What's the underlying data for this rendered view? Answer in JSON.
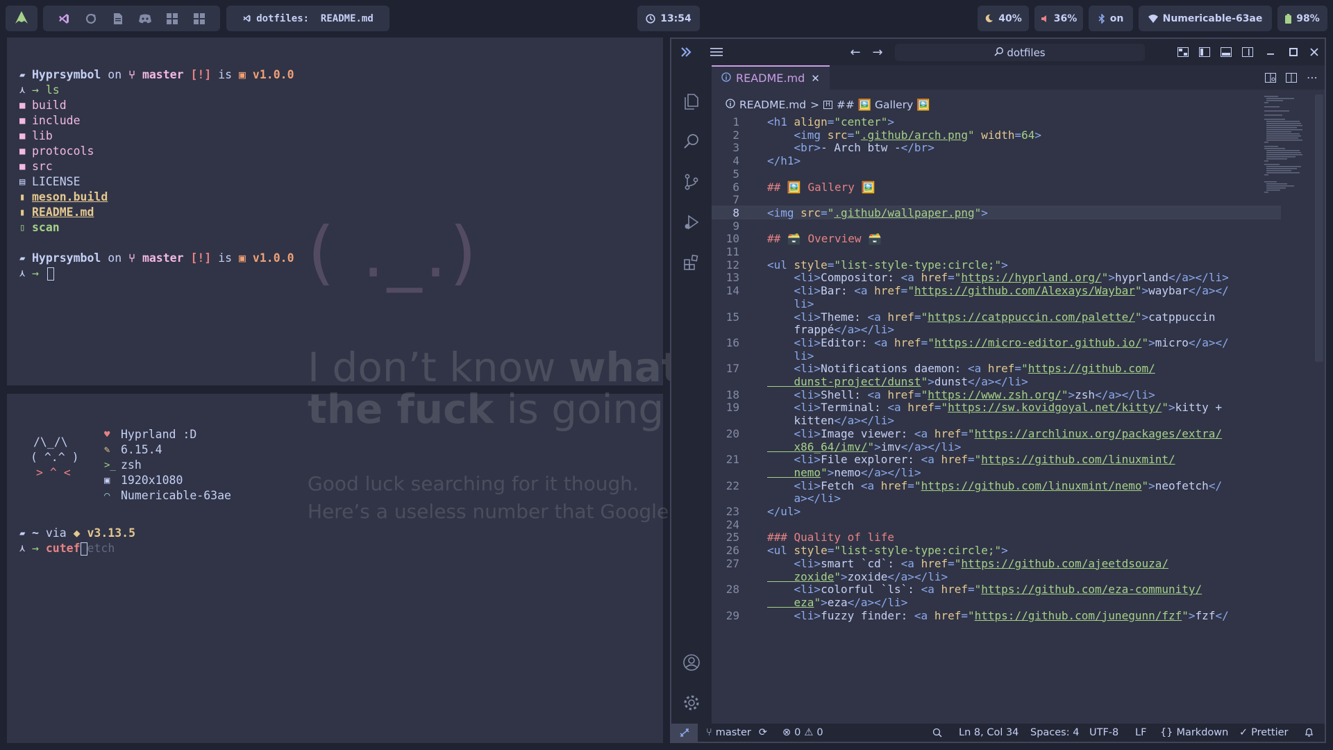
{
  "topbar": {
    "launcher_icon": "arch-icon",
    "workspace_icons": [
      "vscode-icon",
      "refresh-icon",
      "file-icon",
      "discord-icon",
      "grid-icon",
      "grid-icon"
    ],
    "window_title": "dotfiles:  README.md",
    "clock": "13:54",
    "brightness": "40%",
    "volume": "36%",
    "bluetooth": "on",
    "network": "Numericable-63ae",
    "battery": "98%"
  },
  "terminal_top": {
    "prompt1": {
      "user": "Hyprsymbol",
      "on": "on",
      "branch": "master",
      "status": "[!]",
      "is": "is",
      "version": "v1.0.0",
      "symbol": "→",
      "command": "ls"
    },
    "files": [
      {
        "name": "build",
        "type": "dir"
      },
      {
        "name": "include",
        "type": "dir"
      },
      {
        "name": "lib",
        "type": "dir"
      },
      {
        "name": "protocols",
        "type": "dir"
      },
      {
        "name": "src",
        "type": "dir"
      },
      {
        "name": "LICENSE",
        "type": "file"
      },
      {
        "name": "meson.build",
        "type": "build"
      },
      {
        "name": "README.md",
        "type": "readme"
      },
      {
        "name": "scan",
        "type": "exec"
      }
    ],
    "prompt2": {
      "user": "Hyprsymbol",
      "on": "on",
      "branch": "master",
      "status": "[!]",
      "is": "is",
      "version": "v1.0.0",
      "symbol": "→"
    }
  },
  "wallpaper": {
    "face": "( ._.)",
    "line1_a": "I don’t know ",
    "line1_b": "what",
    "line2_a": "the fuck",
    "line2_b": " is going o",
    "sub1": "Good luck searching for it though.",
    "sub2": "Here’s a useless number that Google h"
  },
  "terminal_bottom": {
    "ascii": [
      "/\\_/\\",
      "( ^.^ )",
      "> ^ <"
    ],
    "info": [
      {
        "icon": "heart-icon",
        "text": "Hyprland :D"
      },
      {
        "icon": "wrench-icon",
        "text": "6.15.4"
      },
      {
        "icon": "terminal-icon",
        "text": "zsh"
      },
      {
        "icon": "image-icon",
        "text": "1920x1080"
      },
      {
        "icon": "wifi-icon",
        "text": "Numericable-63ae"
      }
    ],
    "prompt": {
      "dir": "~",
      "via": "via",
      "lang_version": "v3.13.5",
      "symbol": "→",
      "typed": "cutef",
      "suggestion": "etch"
    }
  },
  "vscode": {
    "search_text": "dotfiles",
    "tab_label": "README.md",
    "breadcrumb": {
      "file": "README.md",
      "sep": ">",
      "section": "## 🖼️ Gallery 🖼️"
    },
    "lines": [
      {
        "n": "1",
        "t": [
          [
            "tag",
            "<h1 "
          ],
          [
            "attr",
            "align"
          ],
          [
            "tag",
            "="
          ],
          [
            "str",
            "\"center\""
          ],
          [
            "tag",
            ">"
          ]
        ]
      },
      {
        "n": "2",
        "t": [
          [
            "tag",
            "    <img "
          ],
          [
            "attr",
            "src"
          ],
          [
            "tag",
            "="
          ],
          [
            "str",
            "\""
          ],
          [
            "link",
            ".github/arch.png"
          ],
          [
            "str",
            "\""
          ],
          [
            "attr",
            " width"
          ],
          [
            "tag",
            "="
          ],
          [
            "str",
            "64"
          ],
          [
            "tag",
            ">"
          ]
        ]
      },
      {
        "n": "3",
        "t": [
          [
            "tag",
            "    <br>"
          ],
          [
            "plain",
            "- Arch btw -"
          ],
          [
            "tag",
            "</br>"
          ]
        ]
      },
      {
        "n": "4",
        "t": [
          [
            "tag",
            "</h1>"
          ]
        ]
      },
      {
        "n": "5",
        "t": []
      },
      {
        "n": "6",
        "t": [
          [
            "head",
            "## 🖼️ Gallery 🖼️"
          ]
        ]
      },
      {
        "n": "7",
        "t": []
      },
      {
        "n": "8",
        "t": [
          [
            "tag",
            "<img "
          ],
          [
            "attr",
            "src"
          ],
          [
            "tag",
            "="
          ],
          [
            "str",
            "\""
          ],
          [
            "link",
            ".github/wallpaper.png"
          ],
          [
            "str",
            "\""
          ],
          [
            "tag",
            ">"
          ]
        ]
      },
      {
        "n": "9",
        "t": []
      },
      {
        "n": "10",
        "t": [
          [
            "head",
            "## 🗃️ Overview 🗃️"
          ]
        ]
      },
      {
        "n": "11",
        "t": []
      },
      {
        "n": "12",
        "t": [
          [
            "tag",
            "<ul "
          ],
          [
            "attr",
            "style"
          ],
          [
            "tag",
            "="
          ],
          [
            "str",
            "\"list-style-type:circle;\""
          ],
          [
            "tag",
            ">"
          ]
        ]
      },
      {
        "n": "13",
        "t": [
          [
            "tag",
            "    <li>"
          ],
          [
            "plain",
            "Compositor: "
          ],
          [
            "tag",
            "<a "
          ],
          [
            "attr",
            "href"
          ],
          [
            "tag",
            "="
          ],
          [
            "str",
            "\""
          ],
          [
            "link",
            "https://hyprland.org/"
          ],
          [
            "str",
            "\""
          ],
          [
            "tag",
            ">"
          ],
          [
            "plain",
            "hyprland"
          ],
          [
            "tag",
            "</a></li>"
          ]
        ]
      },
      {
        "n": "14",
        "t": [
          [
            "tag",
            "    <li>"
          ],
          [
            "plain",
            "Bar: "
          ],
          [
            "tag",
            "<a "
          ],
          [
            "attr",
            "href"
          ],
          [
            "tag",
            "="
          ],
          [
            "str",
            "\""
          ],
          [
            "link",
            "https://github.com/Alexays/Waybar"
          ],
          [
            "str",
            "\""
          ],
          [
            "tag",
            ">"
          ],
          [
            "plain",
            "waybar"
          ],
          [
            "tag",
            "</a></"
          ]
        ]
      },
      {
        "n": "",
        "t": [
          [
            "tag",
            "    li>"
          ]
        ]
      },
      {
        "n": "15",
        "t": [
          [
            "tag",
            "    <li>"
          ],
          [
            "plain",
            "Theme: "
          ],
          [
            "tag",
            "<a "
          ],
          [
            "attr",
            "href"
          ],
          [
            "tag",
            "="
          ],
          [
            "str",
            "\""
          ],
          [
            "link",
            "https://catppuccin.com/palette/"
          ],
          [
            "str",
            "\""
          ],
          [
            "tag",
            ">"
          ],
          [
            "plain",
            "catppuccin"
          ]
        ]
      },
      {
        "n": "",
        "t": [
          [
            "plain",
            "    frappé"
          ],
          [
            "tag",
            "</a></li>"
          ]
        ]
      },
      {
        "n": "16",
        "t": [
          [
            "tag",
            "    <li>"
          ],
          [
            "plain",
            "Editor: "
          ],
          [
            "tag",
            "<a "
          ],
          [
            "attr",
            "href"
          ],
          [
            "tag",
            "="
          ],
          [
            "str",
            "\""
          ],
          [
            "link",
            "https://micro-editor.github.io/"
          ],
          [
            "str",
            "\""
          ],
          [
            "tag",
            ">"
          ],
          [
            "plain",
            "micro"
          ],
          [
            "tag",
            "</a></"
          ]
        ]
      },
      {
        "n": "",
        "t": [
          [
            "tag",
            "    li>"
          ]
        ]
      },
      {
        "n": "17",
        "t": [
          [
            "tag",
            "    <li>"
          ],
          [
            "plain",
            "Notifications daemon: "
          ],
          [
            "tag",
            "<a "
          ],
          [
            "attr",
            "href"
          ],
          [
            "tag",
            "="
          ],
          [
            "str",
            "\""
          ],
          [
            "link",
            "https://github.com/"
          ]
        ]
      },
      {
        "n": "",
        "t": [
          [
            "link",
            "    dunst-project/dunst"
          ],
          [
            "str",
            "\""
          ],
          [
            "tag",
            ">"
          ],
          [
            "plain",
            "dunst"
          ],
          [
            "tag",
            "</a></li>"
          ]
        ]
      },
      {
        "n": "18",
        "t": [
          [
            "tag",
            "    <li>"
          ],
          [
            "plain",
            "Shell: "
          ],
          [
            "tag",
            "<a "
          ],
          [
            "attr",
            "href"
          ],
          [
            "tag",
            "="
          ],
          [
            "str",
            "\""
          ],
          [
            "link",
            "https://www.zsh.org/"
          ],
          [
            "str",
            "\""
          ],
          [
            "tag",
            ">"
          ],
          [
            "plain",
            "zsh"
          ],
          [
            "tag",
            "</a></li>"
          ]
        ]
      },
      {
        "n": "19",
        "t": [
          [
            "tag",
            "    <li>"
          ],
          [
            "plain",
            "Terminal: "
          ],
          [
            "tag",
            "<a "
          ],
          [
            "attr",
            "href"
          ],
          [
            "tag",
            "="
          ],
          [
            "str",
            "\""
          ],
          [
            "link",
            "https://sw.kovidgoyal.net/kitty/"
          ],
          [
            "str",
            "\""
          ],
          [
            "tag",
            ">"
          ],
          [
            "plain",
            "kitty +"
          ]
        ]
      },
      {
        "n": "",
        "t": [
          [
            "plain",
            "    kitten"
          ],
          [
            "tag",
            "</a></li>"
          ]
        ]
      },
      {
        "n": "20",
        "t": [
          [
            "tag",
            "    <li>"
          ],
          [
            "plain",
            "Image viewer: "
          ],
          [
            "tag",
            "<a "
          ],
          [
            "attr",
            "href"
          ],
          [
            "tag",
            "="
          ],
          [
            "str",
            "\""
          ],
          [
            "link",
            "https://archlinux.org/packages/extra/"
          ]
        ]
      },
      {
        "n": "",
        "t": [
          [
            "link",
            "    x86_64/imv/"
          ],
          [
            "str",
            "\""
          ],
          [
            "tag",
            ">"
          ],
          [
            "plain",
            "imv"
          ],
          [
            "tag",
            "</a></li>"
          ]
        ]
      },
      {
        "n": "21",
        "t": [
          [
            "tag",
            "    <li>"
          ],
          [
            "plain",
            "File explorer: "
          ],
          [
            "tag",
            "<a "
          ],
          [
            "attr",
            "href"
          ],
          [
            "tag",
            "="
          ],
          [
            "str",
            "\""
          ],
          [
            "link",
            "https://github.com/linuxmint/"
          ]
        ]
      },
      {
        "n": "",
        "t": [
          [
            "link",
            "    nemo"
          ],
          [
            "str",
            "\""
          ],
          [
            "tag",
            ">"
          ],
          [
            "plain",
            "nemo"
          ],
          [
            "tag",
            "</a></li>"
          ]
        ]
      },
      {
        "n": "22",
        "t": [
          [
            "tag",
            "    <li>"
          ],
          [
            "plain",
            "Fetch "
          ],
          [
            "tag",
            "<a "
          ],
          [
            "attr",
            "href"
          ],
          [
            "tag",
            "="
          ],
          [
            "str",
            "\""
          ],
          [
            "link",
            "https://github.com/linuxmint/nemo"
          ],
          [
            "str",
            "\""
          ],
          [
            "tag",
            ">"
          ],
          [
            "plain",
            "neofetch"
          ],
          [
            "tag",
            "</"
          ]
        ]
      },
      {
        "n": "",
        "t": [
          [
            "tag",
            "    a></li>"
          ]
        ]
      },
      {
        "n": "23",
        "t": [
          [
            "tag",
            "</ul>"
          ]
        ]
      },
      {
        "n": "24",
        "t": []
      },
      {
        "n": "25",
        "t": [
          [
            "head",
            "### Quality of life"
          ]
        ]
      },
      {
        "n": "26",
        "t": [
          [
            "tag",
            "<ul "
          ],
          [
            "attr",
            "style"
          ],
          [
            "tag",
            "="
          ],
          [
            "str",
            "\"list-style-type:circle;\""
          ],
          [
            "tag",
            ">"
          ]
        ]
      },
      {
        "n": "27",
        "t": [
          [
            "tag",
            "    <li>"
          ],
          [
            "plain",
            "smart `cd`: "
          ],
          [
            "tag",
            "<a "
          ],
          [
            "attr",
            "href"
          ],
          [
            "tag",
            "="
          ],
          [
            "str",
            "\""
          ],
          [
            "link",
            "https://github.com/ajeetdsouza/"
          ]
        ]
      },
      {
        "n": "",
        "t": [
          [
            "link",
            "    zoxide"
          ],
          [
            "str",
            "\""
          ],
          [
            "tag",
            ">"
          ],
          [
            "plain",
            "zoxide"
          ],
          [
            "tag",
            "</a></li>"
          ]
        ]
      },
      {
        "n": "28",
        "t": [
          [
            "tag",
            "    <li>"
          ],
          [
            "plain",
            "colorful `ls`: "
          ],
          [
            "tag",
            "<a "
          ],
          [
            "attr",
            "href"
          ],
          [
            "tag",
            "="
          ],
          [
            "str",
            "\""
          ],
          [
            "link",
            "https://github.com/eza-community/"
          ]
        ]
      },
      {
        "n": "",
        "t": [
          [
            "link",
            "    eza"
          ],
          [
            "str",
            "\""
          ],
          [
            "tag",
            ">"
          ],
          [
            "plain",
            "eza"
          ],
          [
            "tag",
            "</a></li>"
          ]
        ]
      },
      {
        "n": "29",
        "t": [
          [
            "tag",
            "    <li>"
          ],
          [
            "plain",
            "fuzzy finder: "
          ],
          [
            "tag",
            "<a "
          ],
          [
            "attr",
            "href"
          ],
          [
            "tag",
            "="
          ],
          [
            "str",
            "\""
          ],
          [
            "link",
            "https://github.com/junegunn/fzf"
          ],
          [
            "str",
            "\""
          ],
          [
            "tag",
            ">"
          ],
          [
            "plain",
            "fzf"
          ],
          [
            "tag",
            "</"
          ]
        ]
      }
    ],
    "active_line": "8",
    "status": {
      "branch": "master",
      "errors": "0",
      "warnings": "0",
      "position": "Ln 8, Col 34",
      "spaces": "Spaces: 4",
      "encoding": "UTF-8",
      "eol": "LF",
      "language": "Markdown",
      "formatter": "Prettier"
    }
  },
  "colors": {
    "background": "#1f2230",
    "panel": "#303446",
    "accent": "#ca9ee6",
    "pink": "#f4b8e4",
    "red": "#e78284",
    "orange": "#ef9f76",
    "yellow": "#e5c890",
    "green": "#a6d189",
    "blue": "#8caaee"
  }
}
